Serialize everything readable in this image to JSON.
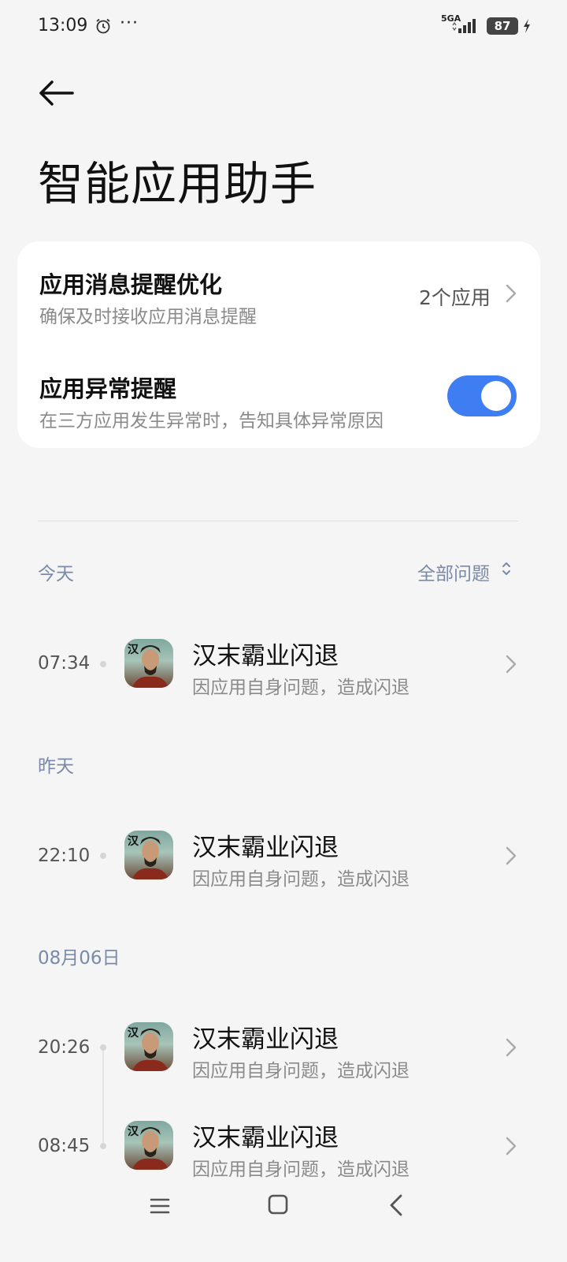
{
  "status_bar": {
    "time": "13:09",
    "network": "5GA",
    "battery": "87",
    "icons": [
      "alarm-icon",
      "more-dots-icon",
      "signal-icon",
      "battery-icon",
      "charging-icon"
    ]
  },
  "header": {
    "title": "智能应用助手"
  },
  "settings": {
    "message_optimization": {
      "title": "应用消息提醒优化",
      "subtitle": "确保及时接收应用消息提醒",
      "value": "2个应用"
    },
    "anomaly_alert": {
      "title": "应用异常提醒",
      "subtitle": "在三方应用发生异常时，告知具体异常原因",
      "enabled": true
    }
  },
  "filter": {
    "label": "全部问题"
  },
  "sections": [
    {
      "label": "今天",
      "entries": [
        {
          "time": "07:34",
          "title": "汉末霸业闪退",
          "subtitle": "因应用自身问题，造成闪退"
        }
      ]
    },
    {
      "label": "昨天",
      "entries": [
        {
          "time": "22:10",
          "title": "汉末霸业闪退",
          "subtitle": "因应用自身问题，造成闪退"
        }
      ]
    },
    {
      "label": "08月06日",
      "entries": [
        {
          "time": "20:26",
          "title": "汉末霸业闪退",
          "subtitle": "因应用自身问题，造成闪退"
        },
        {
          "time": "08:45",
          "title": "汉末霸业闪退",
          "subtitle": "因应用自身问题，造成闪退"
        }
      ]
    }
  ],
  "colors": {
    "accent": "#3f7df2",
    "background": "#f5f5f5",
    "card": "#ffffff",
    "section_label": "#7a8aa8"
  }
}
